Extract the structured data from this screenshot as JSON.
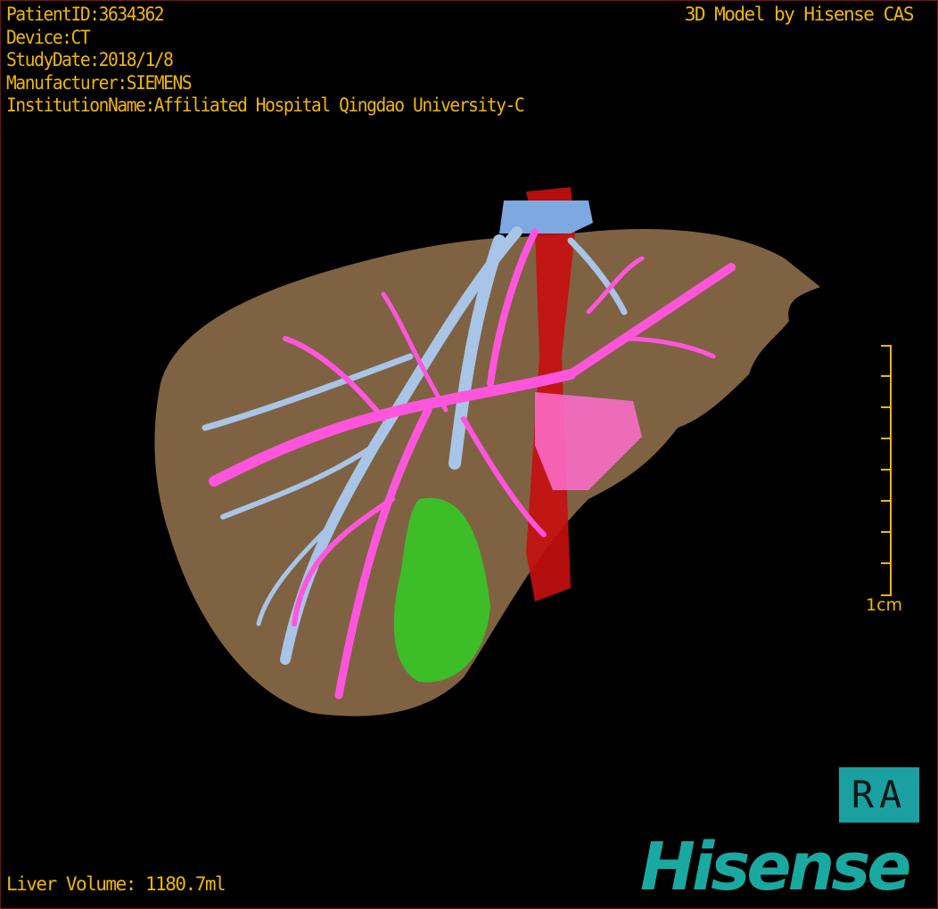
{
  "patient_info": {
    "patient_id": "PatientID:3634362",
    "device": "Device:CT",
    "study_date": "StudyDate:2018/1/8",
    "manufacturer": "Manufacturer:SIEMENS",
    "institution": "InstitutionName:Affiliated Hospital Qingdao University-C"
  },
  "model_title": "3D Model by Hisense CAS",
  "scale_bar": {
    "label": "1cm"
  },
  "orientation": "RA",
  "liver_volume": "Liver Volume: 1180.7ml",
  "logo": "Hisense",
  "colors": {
    "text": "#f2b800",
    "liver": "#8a6a48",
    "portal_vein": "#ff55dd",
    "hepatic_vein": "#9bbbe0",
    "artery": "#d01010",
    "gallbladder": "#33cc22",
    "brand": "#1aa9a1"
  }
}
